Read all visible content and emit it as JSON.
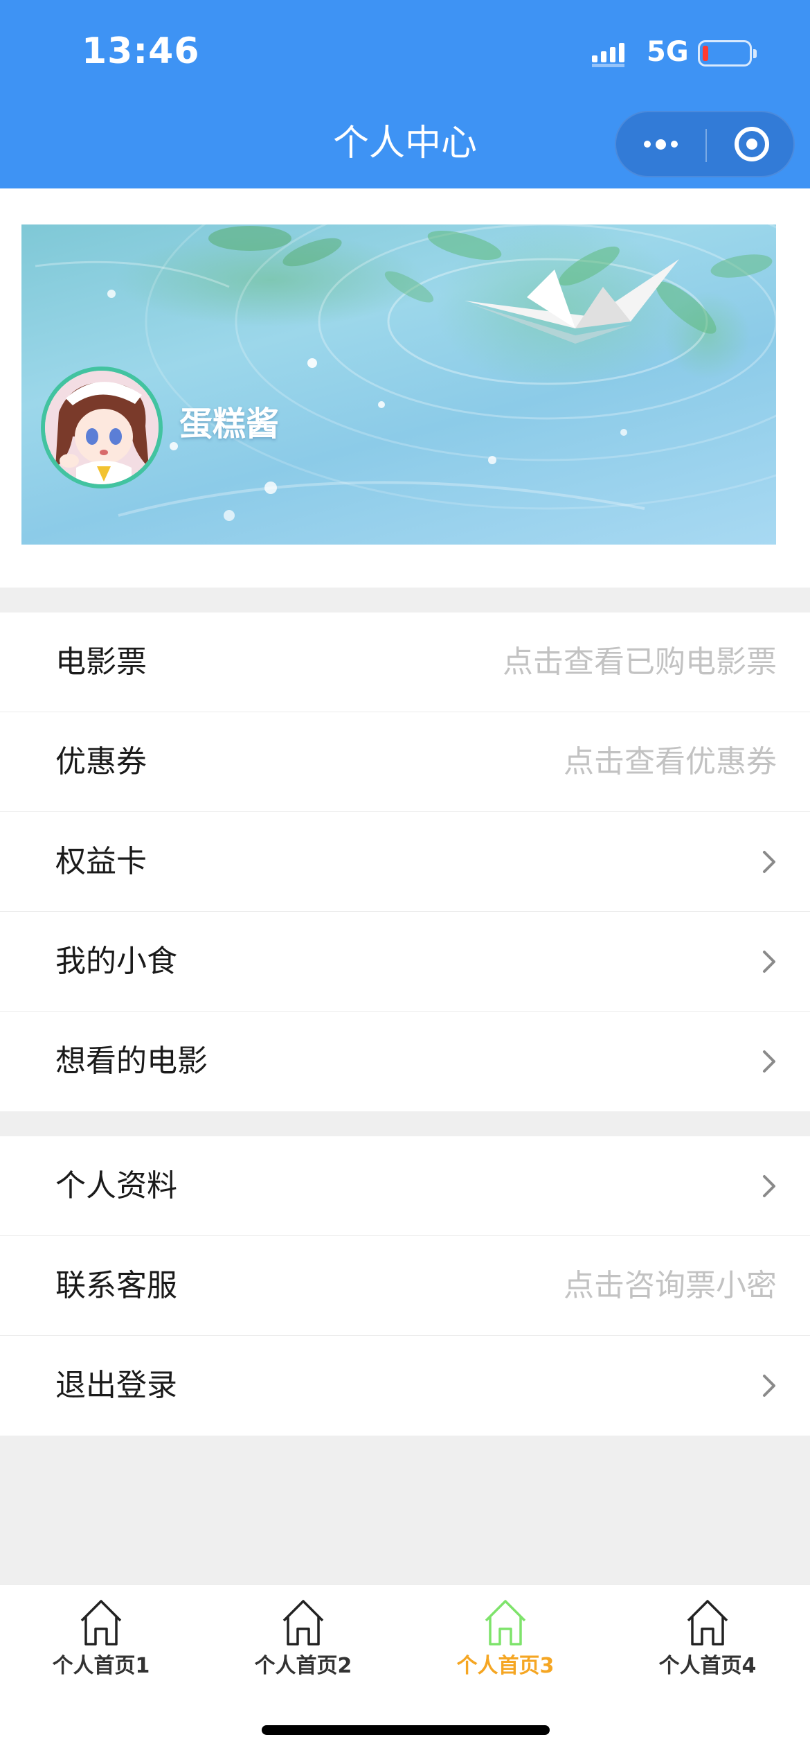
{
  "status_bar": {
    "time": "13:46",
    "network": "5G"
  },
  "header": {
    "title": "个人中心"
  },
  "capsule": {
    "more_icon": "more-dots-icon",
    "close_icon": "target-circle-icon"
  },
  "profile": {
    "username": "蛋糕酱"
  },
  "menu_group_1": [
    {
      "label": "电影票",
      "hint": "点击查看已购电影票"
    },
    {
      "label": "优惠券",
      "hint": "点击查看优惠券"
    },
    {
      "label": "权益卡",
      "icon": "chevron-right-icon"
    },
    {
      "label": "我的小食",
      "icon": "chevron-right-icon"
    },
    {
      "label": "想看的电影",
      "icon": "chevron-right-icon"
    }
  ],
  "menu_group_2": [
    {
      "label": "个人资料",
      "icon": "chevron-right-icon"
    },
    {
      "label": "联系客服",
      "hint": "点击咨询票小密"
    },
    {
      "label": "退出登录",
      "icon": "chevron-right-icon"
    }
  ],
  "tabbar": {
    "tabs": [
      {
        "label": "个人首页1",
        "icon": "home-icon"
      },
      {
        "label": "个人首页2",
        "icon": "home-icon"
      },
      {
        "label": "个人首页3",
        "icon": "home-icon"
      },
      {
        "label": "个人首页4",
        "icon": "home-icon"
      }
    ],
    "active_index": 2
  },
  "colors": {
    "header": "#3e93f4",
    "active_tab": "#f5a623",
    "active_icon": "#7ee36b",
    "avatar_ring": "#42c3a0"
  }
}
